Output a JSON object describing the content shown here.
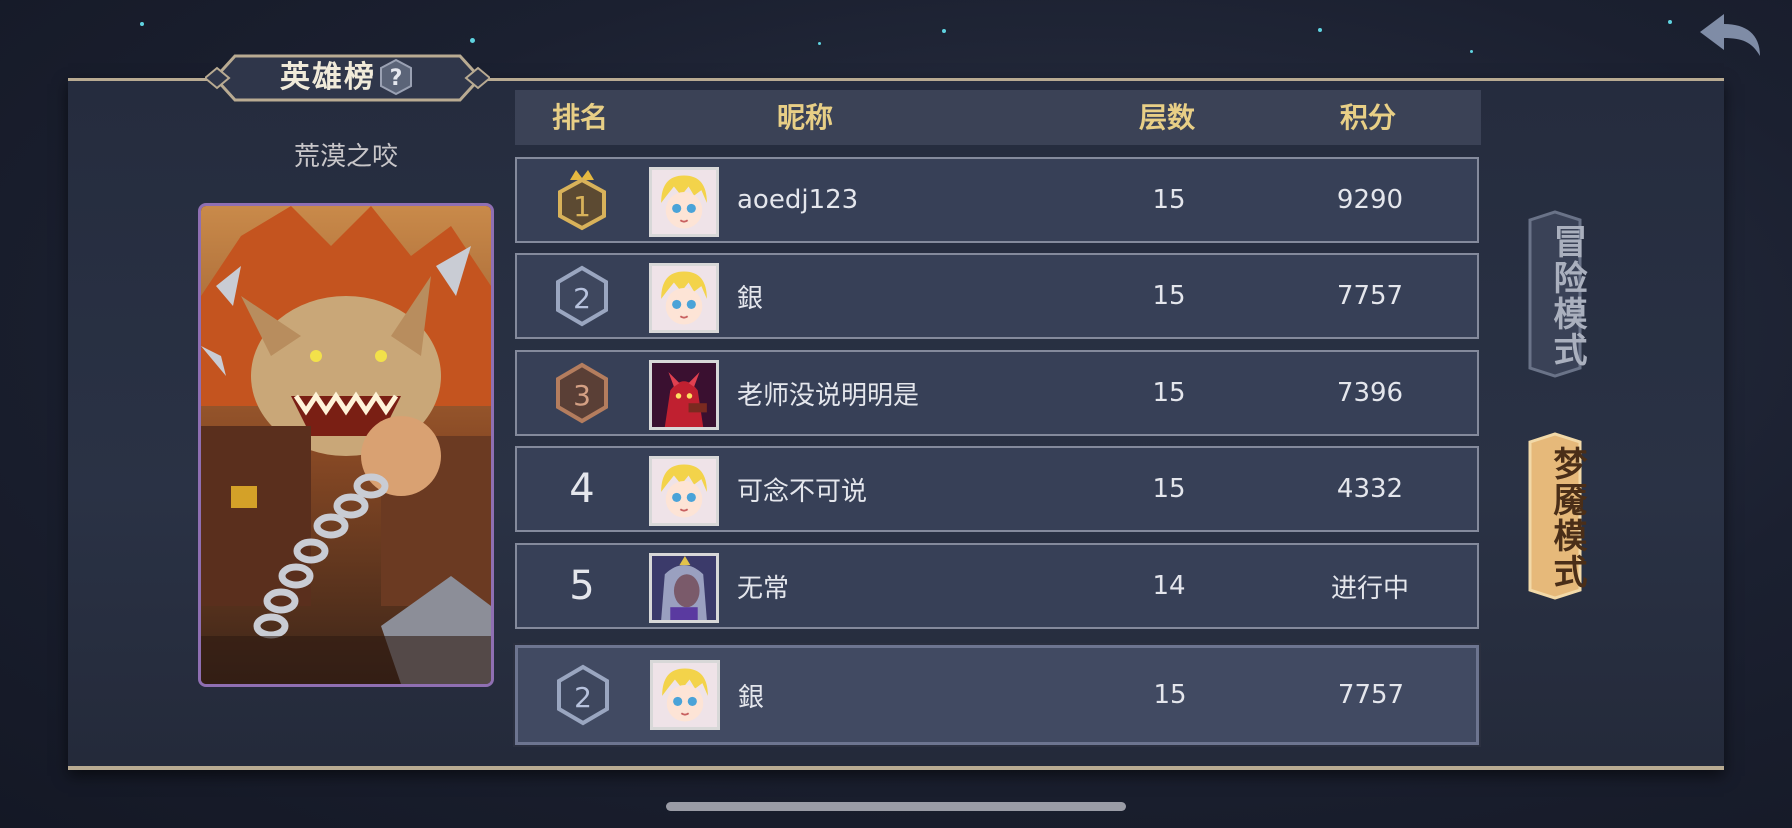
{
  "leaderboard": {
    "title": "英雄榜",
    "boss_name": "荒漠之咬",
    "columns": {
      "rank": "排名",
      "nickname": "昵称",
      "level": "层数",
      "score": "积分"
    },
    "rows": [
      {
        "rank": "1",
        "name": "aoedj123",
        "level": "15",
        "score": "9290"
      },
      {
        "rank": "2",
        "name": "銀",
        "level": "15",
        "score": "7757"
      },
      {
        "rank": "3",
        "name": "老师没说明明是",
        "level": "15",
        "score": "7396"
      },
      {
        "rank": "4",
        "name": "可念不可说",
        "level": "15",
        "score": "4332"
      },
      {
        "rank": "5",
        "name": "无常",
        "level": "14",
        "score": "进行中"
      }
    ],
    "my_row": {
      "rank": "2",
      "name": "銀",
      "level": "15",
      "score": "7757"
    }
  },
  "modes": {
    "adventure": "冒险模式",
    "nightmare": "梦魇模式"
  },
  "icons": {
    "back": "back-arrow-icon",
    "help": "question-icon",
    "rank1": "crown-badge-icon",
    "rank_badge": "hexagon-badge-icon"
  },
  "colors": {
    "header_text": "#e8cf86",
    "gold": "#d8b25a",
    "silver": "#9aa6c0",
    "bronze": "#b47d5e",
    "active_tab": "#e6b97a"
  }
}
